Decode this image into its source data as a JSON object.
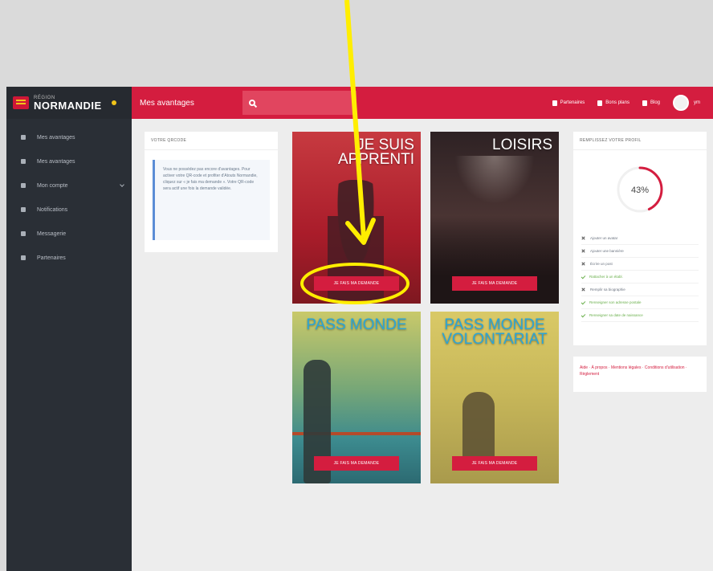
{
  "sidebar": {
    "brand_small": "RÉGION",
    "brand_big": "NORMANDIE",
    "items": [
      {
        "label": "Mes avantages",
        "icon": "tag-icon"
      },
      {
        "label": "Mes avantages",
        "icon": "gift-icon"
      },
      {
        "label": "Mon compte",
        "icon": "user-icon"
      },
      {
        "label": "Notifications",
        "icon": "bell-icon"
      },
      {
        "label": "Messagerie",
        "icon": "mail-icon"
      },
      {
        "label": "Partenaires",
        "icon": "location-icon"
      }
    ]
  },
  "topbar": {
    "title": "Mes avantages",
    "search_placeholder": "",
    "links": [
      {
        "label": "Partenaires",
        "icon": "location-pin-icon"
      },
      {
        "label": "Bons plans",
        "icon": "thumbs-up-icon"
      },
      {
        "label": "Blog",
        "icon": "newspaper-icon"
      }
    ],
    "user": "ym"
  },
  "qr": {
    "header": "VOTRE QRCODE",
    "note": "Vous ne possédez pas encore d'avantages. Pour activer votre QR-code et profiter d'Atouts Normandie, cliquez sur « je fais ma demande ». Votre QR-code sera actif une fois la demande validée."
  },
  "cards": [
    {
      "title": "JE SUIS APPRENTI",
      "button": "JE FAIS MA DEMANDE"
    },
    {
      "title": "LOISIRS",
      "button": "JE FAIS MA DEMANDE"
    },
    {
      "title": "PASS MONDE",
      "button": "JE FAIS MA DEMANDE"
    },
    {
      "title": "PASS MONDE VOLONTARIAT",
      "button": "JE FAIS MA DEMANDE"
    }
  ],
  "profile": {
    "header": "REMPLISSEZ VOTRE PROFIL",
    "percent": 43,
    "percent_label": "43%",
    "accent": "#d41d3f",
    "items": [
      {
        "label": "Ajouter un avatar",
        "done": false
      },
      {
        "label": "Ajouter une bannière",
        "done": false
      },
      {
        "label": "Écrire un post",
        "done": false
      },
      {
        "label": "Rattacher à un établ.",
        "done": true
      },
      {
        "label": "Remplir sa biographie",
        "done": false
      },
      {
        "label": "Renseigner son adresse postale",
        "done": true
      },
      {
        "label": "Renseigner sa date de naissance",
        "done": true
      }
    ]
  },
  "footer_links": {
    "items": [
      "Aide",
      "À propos",
      "Mentions légales",
      "Conditions d'utilisation",
      "Règlement"
    ]
  }
}
